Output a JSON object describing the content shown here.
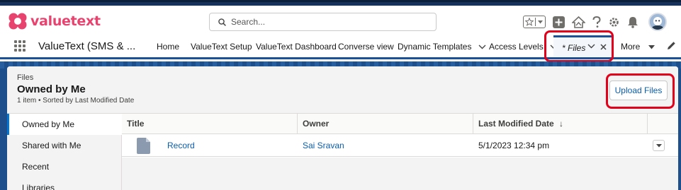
{
  "brand": {
    "name": "valuetext",
    "color": "#e8436e"
  },
  "search": {
    "placeholder": "Search..."
  },
  "header_icons": [
    "favorites-star-icon",
    "favorites-list-icon",
    "global-actions-plus-icon",
    "trailhead-icon",
    "help-icon",
    "setup-gear-icon",
    "notifications-bell-icon",
    "user-avatar"
  ],
  "nav": {
    "app_name": "ValueText (SMS & ...",
    "items": [
      "Home",
      "ValueText Setup",
      "ValueText Dashboard",
      "Converse view",
      "Dynamic Templates",
      "Access Levels"
    ],
    "active_tab": "* Files",
    "more_label": "More"
  },
  "page": {
    "breadcrumb": "Files",
    "title": "Owned by Me",
    "subtitle": "1 item • Sorted by Last Modified Date",
    "upload_button": "Upload Files"
  },
  "sidebar": {
    "items": [
      "Owned by Me",
      "Shared with Me",
      "Recent",
      "Libraries"
    ],
    "selected": "Owned by Me"
  },
  "table": {
    "columns": [
      "Title",
      "Owner",
      "Last Modified Date"
    ],
    "sort_indicator": "↓",
    "rows": [
      {
        "title": "Record",
        "owner": "Sai Sravan",
        "modified": "5/1/2023 12:34 pm"
      }
    ]
  },
  "colors": {
    "accent": "#0176d3",
    "link": "#0b5cab",
    "highlight": "#e3001b",
    "nav_underline": "#1b5297"
  }
}
